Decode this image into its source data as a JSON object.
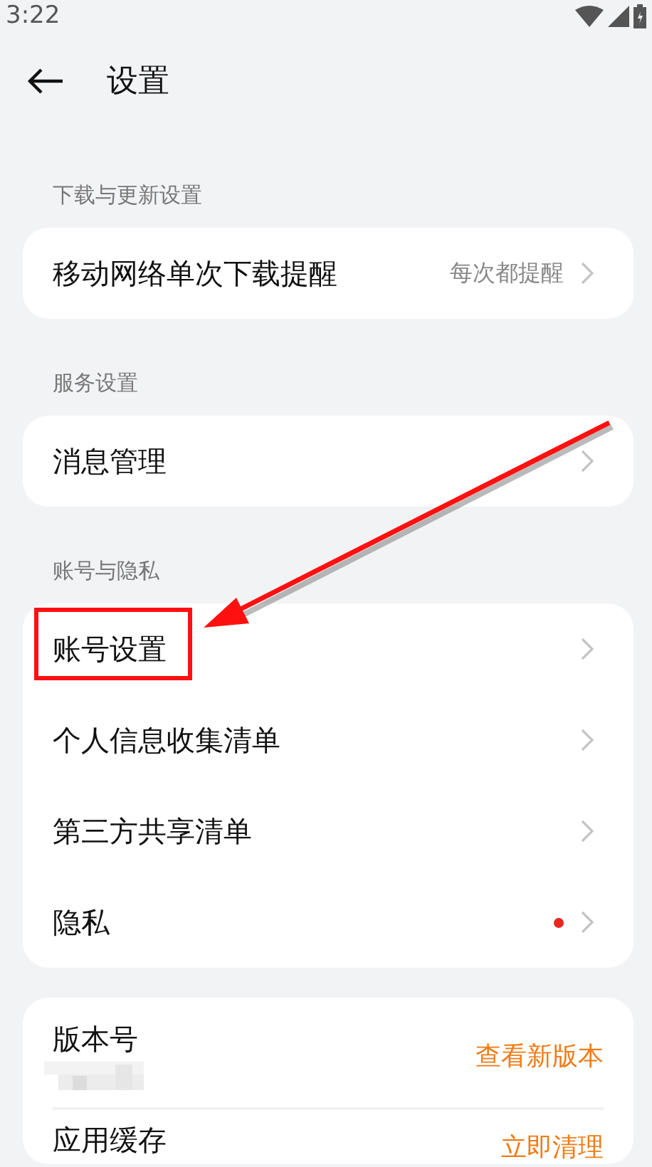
{
  "status_bar": {
    "time": "3:22"
  },
  "header": {
    "title": "设置"
  },
  "sections": [
    {
      "label": "下载与更新设置",
      "items": [
        {
          "kind": "link",
          "title": "移动网络单次下载提醒",
          "value": "每次都提醒",
          "dot": false,
          "highlighted": false
        }
      ]
    },
    {
      "label": "服务设置",
      "items": [
        {
          "kind": "link",
          "title": "消息管理",
          "dot": false,
          "highlighted": false
        }
      ]
    },
    {
      "label": "账号与隐私",
      "items": [
        {
          "kind": "link",
          "title": "账号设置",
          "dot": false,
          "highlighted": true
        },
        {
          "kind": "link",
          "title": "个人信息收集清单",
          "dot": false,
          "highlighted": false
        },
        {
          "kind": "link",
          "title": "第三方共享清单",
          "dot": false,
          "highlighted": false
        },
        {
          "kind": "link",
          "title": "隐私",
          "dot": true,
          "highlighted": false
        }
      ]
    },
    {
      "items": [
        {
          "kind": "action",
          "title": "版本号",
          "redacted": true,
          "action": "查看新版本"
        },
        {
          "kind": "action",
          "title": "应用缓存",
          "redacted": false,
          "action": "立即清理"
        }
      ]
    }
  ]
}
